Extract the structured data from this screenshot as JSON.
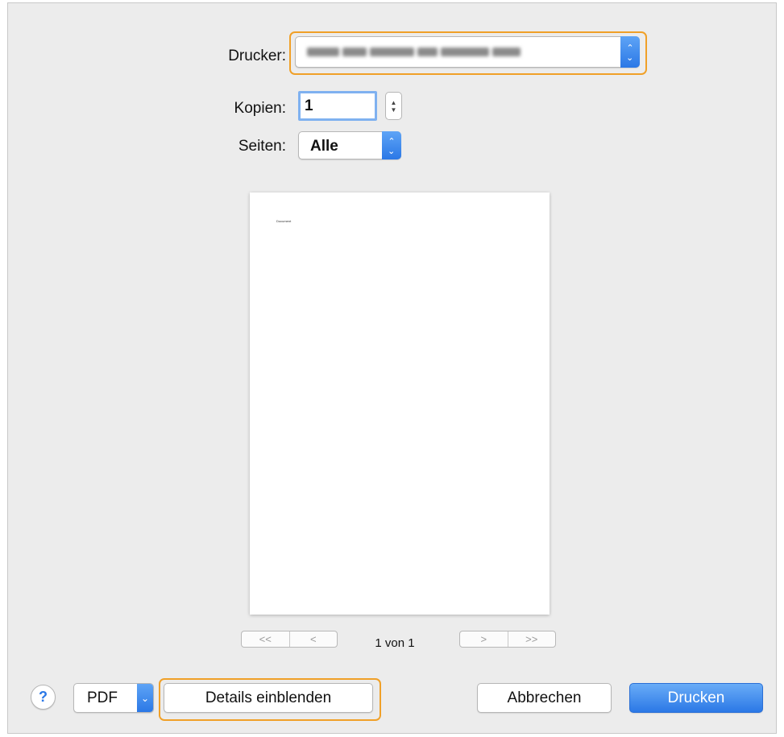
{
  "printer": {
    "label": "Drucker:",
    "value": ""
  },
  "copies": {
    "label": "Kopien:",
    "value": "1"
  },
  "pages": {
    "label": "Seiten:",
    "value": "Alle"
  },
  "preview": {
    "doc_text": "Document",
    "page_indicator": "1 von 1",
    "first": "<<",
    "prev": "<",
    "next": ">",
    "last": ">>"
  },
  "footer": {
    "help": "?",
    "pdf": "PDF",
    "details": "Details einblenden",
    "cancel": "Abbrechen",
    "print": "Drucken"
  },
  "colors": {
    "accent": "#2b78e6",
    "highlight": "#f0a028",
    "background": "#ececec"
  }
}
